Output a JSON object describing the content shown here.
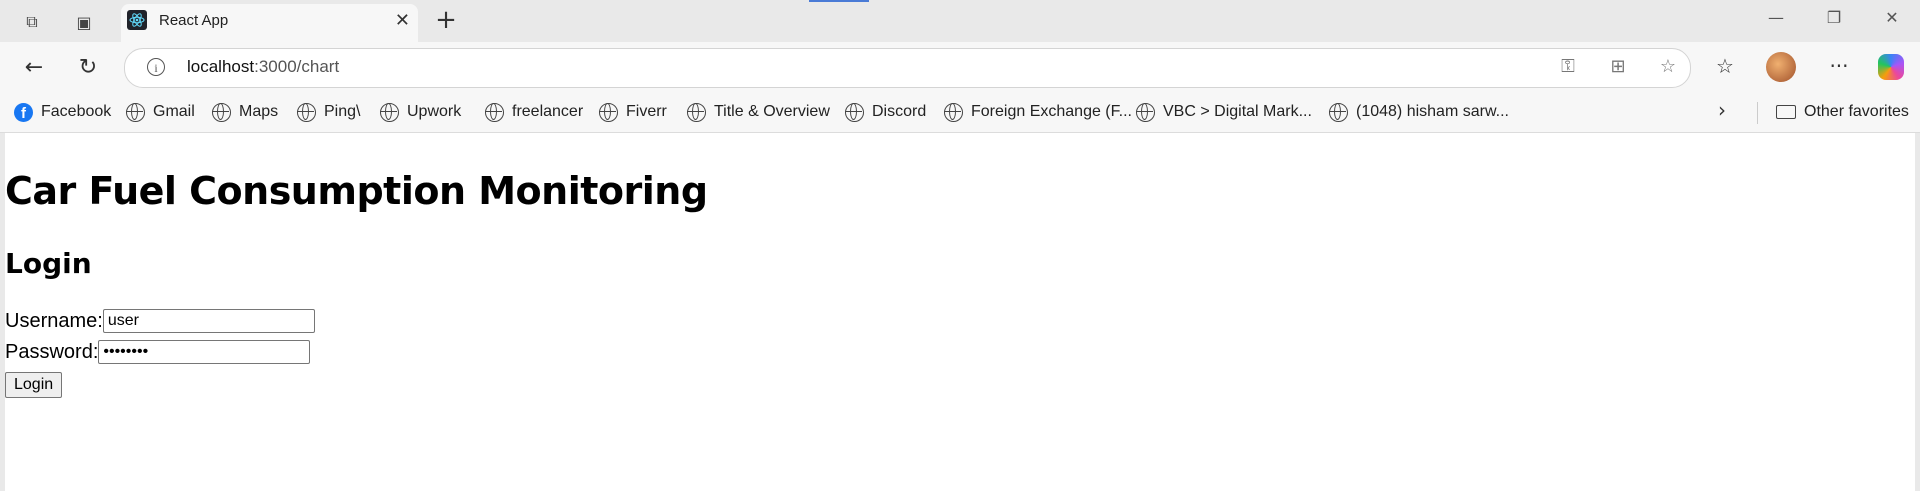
{
  "browser": {
    "tab": {
      "title": "React App"
    },
    "address": {
      "host": "localhost",
      "path": ":3000/chart"
    },
    "bookmarks": [
      {
        "label": "Facebook",
        "icon": "facebook-icon"
      },
      {
        "label": "Gmail",
        "icon": "globe-icon"
      },
      {
        "label": "Maps",
        "icon": "globe-icon"
      },
      {
        "label": "Ping\\",
        "icon": "globe-icon"
      },
      {
        "label": "Upwork",
        "icon": "globe-icon"
      },
      {
        "label": "freelancer",
        "icon": "globe-icon"
      },
      {
        "label": "Fiverr",
        "icon": "globe-icon"
      },
      {
        "label": "Title & Overview",
        "icon": "globe-icon"
      },
      {
        "label": "Discord",
        "icon": "globe-icon"
      },
      {
        "label": "Foreign Exchange (F...",
        "icon": "globe-icon"
      },
      {
        "label": "VBC > Digital Mark...",
        "icon": "globe-icon"
      },
      {
        "label": "(1048) hisham sarw...",
        "icon": "globe-icon"
      }
    ],
    "other_favorites": "Other favorites"
  },
  "page": {
    "title": "Car Fuel Consumption Monitoring",
    "subtitle": "Login",
    "username_label": "Username:",
    "username_value": "user",
    "password_label": "Password:",
    "password_value": "••••••••",
    "login_button": "Login"
  }
}
